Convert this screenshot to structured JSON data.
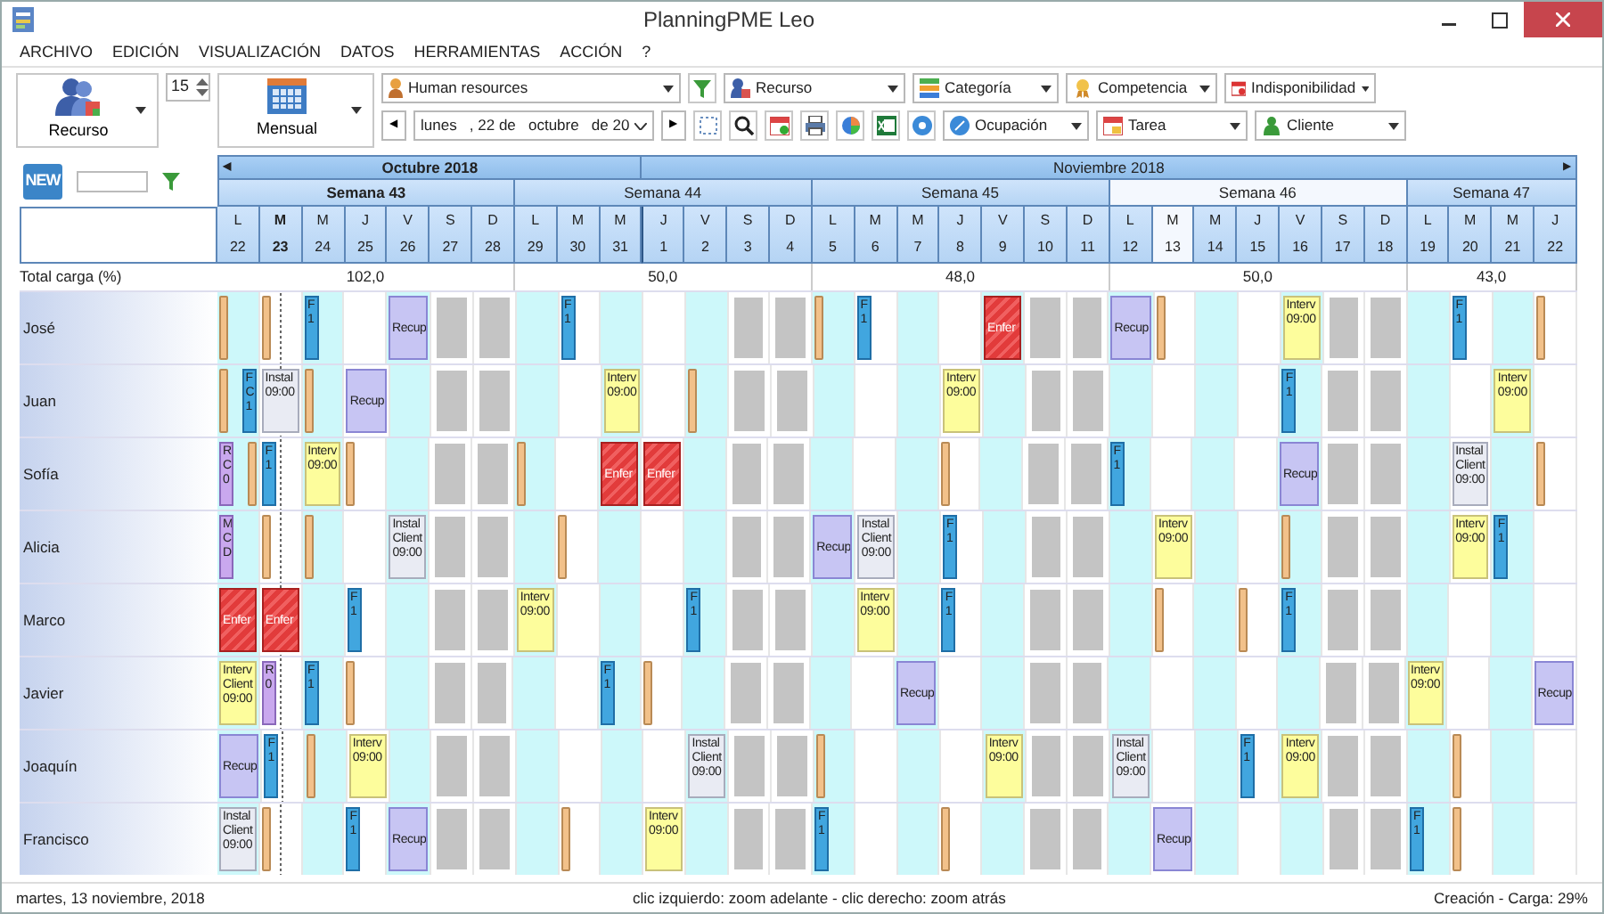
{
  "window": {
    "title": "PlanningPME Leo"
  },
  "menu": [
    {
      "label": "ARCHIVO"
    },
    {
      "label": "EDICIÓN"
    },
    {
      "label": "VISUALIZACIÓN"
    },
    {
      "label": "DATOS"
    },
    {
      "label": "HERRAMIENTAS"
    },
    {
      "label": "ACCIÓN"
    },
    {
      "label": "?"
    }
  ],
  "toolbar": {
    "view_button": {
      "label": "Recurso"
    },
    "count": "15",
    "period_button": {
      "label": "Mensual"
    },
    "resource_group": "Human resources",
    "prev": "◀",
    "date_field": "lunes   , 22 de   octubre   de 20",
    "next": "▶",
    "filters_top": [
      {
        "label": "Recurso"
      },
      {
        "label": "Categoría"
      },
      {
        "label": "Competencia"
      },
      {
        "label": "Indisponibilidad"
      }
    ],
    "filters_bottom": [
      {
        "label": "Ocupación"
      },
      {
        "label": "Tarea"
      },
      {
        "label": "Cliente"
      }
    ]
  },
  "planner": {
    "new_button": "NEW",
    "total_label": "Total carga (%)",
    "prev": "◀",
    "next": "▶",
    "months": [
      {
        "label": "Octubre 2018",
        "current": true
      },
      {
        "label": "Noviembre 2018",
        "current": false
      }
    ],
    "weeks": [
      {
        "label": "Semana 43",
        "total": "102,0",
        "current": true,
        "selected": false,
        "days": [
          {
            "weekday": "L",
            "date": "22",
            "current": false,
            "selected": false,
            "month_start": false
          },
          {
            "weekday": "M",
            "date": "23",
            "current": true,
            "selected": false,
            "month_start": false
          },
          {
            "weekday": "M",
            "date": "24",
            "current": false,
            "selected": false,
            "month_start": false
          },
          {
            "weekday": "J",
            "date": "25",
            "current": false,
            "selected": false,
            "month_start": false
          },
          {
            "weekday": "V",
            "date": "26",
            "current": false,
            "selected": false,
            "month_start": false
          },
          {
            "weekday": "S",
            "date": "27",
            "current": false,
            "selected": false,
            "month_start": false
          },
          {
            "weekday": "D",
            "date": "28",
            "current": false,
            "selected": false,
            "month_start": false
          }
        ]
      },
      {
        "label": "Semana 44",
        "total": "50,0",
        "current": false,
        "selected": false,
        "days": [
          {
            "weekday": "L",
            "date": "29",
            "current": false,
            "selected": false,
            "month_start": false
          },
          {
            "weekday": "M",
            "date": "30",
            "current": false,
            "selected": false,
            "month_start": false
          },
          {
            "weekday": "M",
            "date": "31",
            "current": false,
            "selected": false,
            "month_start": false
          },
          {
            "weekday": "J",
            "date": "1",
            "current": false,
            "selected": false,
            "month_start": true
          },
          {
            "weekday": "V",
            "date": "2",
            "current": false,
            "selected": false,
            "month_start": false
          },
          {
            "weekday": "S",
            "date": "3",
            "current": false,
            "selected": false,
            "month_start": false
          },
          {
            "weekday": "D",
            "date": "4",
            "current": false,
            "selected": false,
            "month_start": false
          }
        ]
      },
      {
        "label": "Semana 45",
        "total": "48,0",
        "current": false,
        "selected": false,
        "days": [
          {
            "weekday": "L",
            "date": "5",
            "current": false,
            "selected": false,
            "month_start": false
          },
          {
            "weekday": "M",
            "date": "6",
            "current": false,
            "selected": false,
            "month_start": false
          },
          {
            "weekday": "M",
            "date": "7",
            "current": false,
            "selected": false,
            "month_start": false
          },
          {
            "weekday": "J",
            "date": "8",
            "current": false,
            "selected": false,
            "month_start": false
          },
          {
            "weekday": "V",
            "date": "9",
            "current": false,
            "selected": false,
            "month_start": false
          },
          {
            "weekday": "S",
            "date": "10",
            "current": false,
            "selected": false,
            "month_start": false
          },
          {
            "weekday": "D",
            "date": "11",
            "current": false,
            "selected": false,
            "month_start": false
          }
        ]
      },
      {
        "label": "Semana 46",
        "total": "50,0",
        "current": false,
        "selected": true,
        "days": [
          {
            "weekday": "L",
            "date": "12",
            "current": false,
            "selected": false,
            "month_start": false
          },
          {
            "weekday": "M",
            "date": "13",
            "current": false,
            "selected": true,
            "month_start": false
          },
          {
            "weekday": "M",
            "date": "14",
            "current": false,
            "selected": false,
            "month_start": false
          },
          {
            "weekday": "J",
            "date": "15",
            "current": false,
            "selected": false,
            "month_start": false
          },
          {
            "weekday": "V",
            "date": "16",
            "current": false,
            "selected": false,
            "month_start": false
          },
          {
            "weekday": "S",
            "date": "17",
            "current": false,
            "selected": false,
            "month_start": false
          },
          {
            "weekday": "D",
            "date": "18",
            "current": false,
            "selected": false,
            "month_start": false
          }
        ]
      },
      {
        "label": "Semana 47",
        "total": "43,0",
        "current": false,
        "selected": false,
        "days": [
          {
            "weekday": "L",
            "date": "19",
            "current": false,
            "selected": false,
            "month_start": false
          },
          {
            "weekday": "M",
            "date": "20",
            "current": false,
            "selected": false,
            "month_start": false
          },
          {
            "weekday": "M",
            "date": "21",
            "current": false,
            "selected": false,
            "month_start": false
          },
          {
            "weekday": "J",
            "date": "22",
            "current": false,
            "selected": false,
            "month_start": false
          }
        ]
      }
    ],
    "resources": [
      {
        "name": "José",
        "cells": [
          {
            "kind": "shaded",
            "events": [
              {
                "kind": "marker"
              }
            ]
          },
          {
            "kind": "plain",
            "events": [
              {
                "kind": "marker"
              }
            ]
          },
          {
            "kind": "shaded",
            "events": [
              {
                "kind": "task",
                "lines": [
                  "F",
                  "1"
                ]
              }
            ]
          },
          {
            "kind": "plain"
          },
          {
            "kind": "shaded",
            "events": [
              {
                "kind": "recup",
                "lines": [
                  "Recup"
                ]
              }
            ]
          },
          {
            "kind": "weekend"
          },
          {
            "kind": "weekend"
          },
          {
            "kind": "shaded"
          },
          {
            "kind": "plain",
            "events": [
              {
                "kind": "task",
                "lines": [
                  "F",
                  "1"
                ]
              }
            ]
          },
          {
            "kind": "shaded"
          },
          {
            "kind": "plain"
          },
          {
            "kind": "shaded"
          },
          {
            "kind": "weekend"
          },
          {
            "kind": "weekend"
          },
          {
            "kind": "shaded",
            "events": [
              {
                "kind": "marker"
              }
            ]
          },
          {
            "kind": "plain",
            "events": [
              {
                "kind": "task",
                "lines": [
                  "F",
                  "1"
                ]
              }
            ]
          },
          {
            "kind": "shaded"
          },
          {
            "kind": "plain"
          },
          {
            "kind": "shaded",
            "events": [
              {
                "kind": "enfer",
                "lines": [
                  "Enfer"
                ]
              }
            ]
          },
          {
            "kind": "weekend"
          },
          {
            "kind": "weekend"
          },
          {
            "kind": "shaded",
            "events": [
              {
                "kind": "recup",
                "lines": [
                  "Recup"
                ]
              }
            ]
          },
          {
            "kind": "plain",
            "events": [
              {
                "kind": "marker"
              }
            ]
          },
          {
            "kind": "shaded"
          },
          {
            "kind": "plain"
          },
          {
            "kind": "shaded",
            "events": [
              {
                "kind": "interv",
                "lines": [
                  "Interv",
                  "09:00"
                ]
              }
            ]
          },
          {
            "kind": "weekend"
          },
          {
            "kind": "weekend"
          },
          {
            "kind": "shaded"
          },
          {
            "kind": "plain",
            "events": [
              {
                "kind": "task",
                "lines": [
                  "F",
                  "1"
                ]
              }
            ]
          },
          {
            "kind": "shaded"
          },
          {
            "kind": "plain",
            "events": [
              {
                "kind": "marker"
              }
            ]
          }
        ]
      },
      {
        "name": "Juan",
        "cells": [
          {
            "kind": "shaded",
            "events": [
              {
                "kind": "marker"
              },
              {
                "kind": "task",
                "lines": [
                  "F",
                  "C",
                  "1"
                ]
              }
            ]
          },
          {
            "kind": "plain",
            "events": [
              {
                "kind": "instal",
                "lines": [
                  "Instal",
                  "09:00"
                ]
              }
            ]
          },
          {
            "kind": "shaded",
            "events": [
              {
                "kind": "marker"
              }
            ]
          },
          {
            "kind": "plain",
            "events": [
              {
                "kind": "recup",
                "lines": [
                  "Recup"
                ]
              }
            ]
          },
          {
            "kind": "shaded"
          },
          {
            "kind": "weekend"
          },
          {
            "kind": "weekend"
          },
          {
            "kind": "shaded"
          },
          {
            "kind": "plain"
          },
          {
            "kind": "shaded",
            "events": [
              {
                "kind": "interv",
                "lines": [
                  "Interv",
                  "09:00"
                ]
              }
            ]
          },
          {
            "kind": "plain"
          },
          {
            "kind": "shaded",
            "events": [
              {
                "kind": "marker"
              }
            ]
          },
          {
            "kind": "weekend"
          },
          {
            "kind": "weekend"
          },
          {
            "kind": "shaded"
          },
          {
            "kind": "plain"
          },
          {
            "kind": "shaded"
          },
          {
            "kind": "plain",
            "events": [
              {
                "kind": "interv",
                "lines": [
                  "Interv",
                  "09:00"
                ]
              }
            ]
          },
          {
            "kind": "shaded"
          },
          {
            "kind": "weekend"
          },
          {
            "kind": "weekend"
          },
          {
            "kind": "shaded"
          },
          {
            "kind": "plain"
          },
          {
            "kind": "shaded"
          },
          {
            "kind": "plain"
          },
          {
            "kind": "shaded",
            "events": [
              {
                "kind": "task",
                "lines": [
                  "F",
                  "1"
                ]
              }
            ]
          },
          {
            "kind": "weekend"
          },
          {
            "kind": "weekend"
          },
          {
            "kind": "shaded"
          },
          {
            "kind": "plain"
          },
          {
            "kind": "shaded",
            "events": [
              {
                "kind": "interv",
                "lines": [
                  "Interv",
                  "09:00"
                ]
              }
            ]
          },
          {
            "kind": "plain"
          }
        ]
      },
      {
        "name": "Sofía",
        "cells": [
          {
            "kind": "shaded",
            "events": [
              {
                "kind": "note",
                "lines": [
                  "R",
                  "C",
                  "0"
                ]
              },
              {
                "kind": "marker"
              }
            ]
          },
          {
            "kind": "plain",
            "events": [
              {
                "kind": "task",
                "lines": [
                  "F",
                  "1"
                ]
              }
            ]
          },
          {
            "kind": "shaded",
            "events": [
              {
                "kind": "interv",
                "lines": [
                  "Interv",
                  "09:00"
                ]
              }
            ]
          },
          {
            "kind": "plain",
            "events": [
              {
                "kind": "marker"
              }
            ]
          },
          {
            "kind": "shaded"
          },
          {
            "kind": "weekend"
          },
          {
            "kind": "weekend"
          },
          {
            "kind": "shaded",
            "events": [
              {
                "kind": "marker"
              }
            ]
          },
          {
            "kind": "plain"
          },
          {
            "kind": "shaded",
            "events": [
              {
                "kind": "enfer",
                "lines": [
                  "Enfer"
                ]
              }
            ]
          },
          {
            "kind": "plain",
            "events": [
              {
                "kind": "enfer",
                "lines": [
                  "Enfer"
                ]
              }
            ]
          },
          {
            "kind": "shaded"
          },
          {
            "kind": "weekend"
          },
          {
            "kind": "weekend"
          },
          {
            "kind": "shaded"
          },
          {
            "kind": "plain"
          },
          {
            "kind": "shaded"
          },
          {
            "kind": "plain",
            "events": [
              {
                "kind": "marker"
              }
            ]
          },
          {
            "kind": "shaded"
          },
          {
            "kind": "weekend"
          },
          {
            "kind": "weekend"
          },
          {
            "kind": "shaded",
            "events": [
              {
                "kind": "task",
                "lines": [
                  "F",
                  "1"
                ]
              }
            ]
          },
          {
            "kind": "plain"
          },
          {
            "kind": "shaded"
          },
          {
            "kind": "plain"
          },
          {
            "kind": "shaded",
            "events": [
              {
                "kind": "recup",
                "lines": [
                  "Recup"
                ]
              }
            ]
          },
          {
            "kind": "weekend"
          },
          {
            "kind": "weekend"
          },
          {
            "kind": "shaded"
          },
          {
            "kind": "plain",
            "events": [
              {
                "kind": "instal",
                "lines": [
                  "Instal",
                  "Client",
                  "09:00"
                ]
              }
            ]
          },
          {
            "kind": "shaded"
          },
          {
            "kind": "plain",
            "events": [
              {
                "kind": "marker"
              }
            ]
          }
        ]
      },
      {
        "name": "Alicia",
        "cells": [
          {
            "kind": "shaded",
            "events": [
              {
                "kind": "note",
                "lines": [
                  "M",
                  "C",
                  "D"
                ]
              }
            ]
          },
          {
            "kind": "plain",
            "events": [
              {
                "kind": "marker"
              }
            ]
          },
          {
            "kind": "shaded",
            "events": [
              {
                "kind": "marker"
              }
            ]
          },
          {
            "kind": "plain"
          },
          {
            "kind": "shaded",
            "events": [
              {
                "kind": "instal",
                "lines": [
                  "Instal",
                  "Client",
                  "09:00"
                ]
              }
            ]
          },
          {
            "kind": "weekend"
          },
          {
            "kind": "weekend"
          },
          {
            "kind": "shaded"
          },
          {
            "kind": "plain",
            "events": [
              {
                "kind": "marker"
              }
            ]
          },
          {
            "kind": "shaded"
          },
          {
            "kind": "plain"
          },
          {
            "kind": "shaded"
          },
          {
            "kind": "weekend"
          },
          {
            "kind": "weekend"
          },
          {
            "kind": "shaded",
            "events": [
              {
                "kind": "recup",
                "lines": [
                  "Recup"
                ]
              }
            ]
          },
          {
            "kind": "plain",
            "events": [
              {
                "kind": "instal",
                "lines": [
                  "Instal",
                  "Client",
                  "09:00"
                ]
              }
            ]
          },
          {
            "kind": "shaded"
          },
          {
            "kind": "plain",
            "events": [
              {
                "kind": "task",
                "lines": [
                  "F",
                  "1"
                ]
              }
            ]
          },
          {
            "kind": "shaded"
          },
          {
            "kind": "weekend"
          },
          {
            "kind": "weekend"
          },
          {
            "kind": "shaded"
          },
          {
            "kind": "plain",
            "events": [
              {
                "kind": "interv",
                "lines": [
                  "Interv",
                  "09:00"
                ]
              }
            ]
          },
          {
            "kind": "shaded"
          },
          {
            "kind": "plain"
          },
          {
            "kind": "shaded",
            "events": [
              {
                "kind": "marker"
              }
            ]
          },
          {
            "kind": "weekend"
          },
          {
            "kind": "weekend"
          },
          {
            "kind": "shaded"
          },
          {
            "kind": "plain",
            "events": [
              {
                "kind": "interv",
                "lines": [
                  "Interv",
                  "09:00"
                ]
              }
            ]
          },
          {
            "kind": "shaded",
            "events": [
              {
                "kind": "task",
                "lines": [
                  "F",
                  "1"
                ]
              }
            ]
          },
          {
            "kind": "plain"
          }
        ]
      },
      {
        "name": "Marco",
        "cells": [
          {
            "kind": "shaded",
            "events": [
              {
                "kind": "enfer",
                "lines": [
                  "Enfer"
                ]
              }
            ]
          },
          {
            "kind": "plain",
            "events": [
              {
                "kind": "enfer",
                "lines": [
                  "Enfer"
                ]
              }
            ]
          },
          {
            "kind": "shaded"
          },
          {
            "kind": "plain",
            "events": [
              {
                "kind": "task",
                "lines": [
                  "F",
                  "1"
                ]
              }
            ]
          },
          {
            "kind": "shaded"
          },
          {
            "kind": "weekend"
          },
          {
            "kind": "weekend"
          },
          {
            "kind": "shaded",
            "events": [
              {
                "kind": "interv",
                "lines": [
                  "Interv",
                  "09:00"
                ]
              }
            ]
          },
          {
            "kind": "plain"
          },
          {
            "kind": "shaded"
          },
          {
            "kind": "plain"
          },
          {
            "kind": "shaded",
            "events": [
              {
                "kind": "task",
                "lines": [
                  "F",
                  "1"
                ]
              }
            ]
          },
          {
            "kind": "weekend"
          },
          {
            "kind": "weekend"
          },
          {
            "kind": "shaded"
          },
          {
            "kind": "plain",
            "events": [
              {
                "kind": "interv",
                "lines": [
                  "Interv",
                  "09:00"
                ]
              }
            ]
          },
          {
            "kind": "shaded"
          },
          {
            "kind": "plain",
            "events": [
              {
                "kind": "task",
                "lines": [
                  "F",
                  "1"
                ]
              }
            ]
          },
          {
            "kind": "shaded"
          },
          {
            "kind": "weekend"
          },
          {
            "kind": "weekend"
          },
          {
            "kind": "shaded"
          },
          {
            "kind": "plain",
            "events": [
              {
                "kind": "marker"
              }
            ]
          },
          {
            "kind": "shaded"
          },
          {
            "kind": "plain",
            "events": [
              {
                "kind": "marker"
              }
            ]
          },
          {
            "kind": "shaded",
            "events": [
              {
                "kind": "task",
                "lines": [
                  "F",
                  "1"
                ]
              }
            ]
          },
          {
            "kind": "weekend"
          },
          {
            "kind": "weekend"
          },
          {
            "kind": "shaded"
          },
          {
            "kind": "plain"
          },
          {
            "kind": "shaded"
          },
          {
            "kind": "plain"
          }
        ]
      },
      {
        "name": "Javier",
        "cells": [
          {
            "kind": "shaded",
            "events": [
              {
                "kind": "interv",
                "lines": [
                  "Interv",
                  "Client",
                  "09:00"
                ]
              }
            ]
          },
          {
            "kind": "plain",
            "events": [
              {
                "kind": "note",
                "lines": [
                  "R",
                  "0"
                ]
              }
            ]
          },
          {
            "kind": "shaded",
            "events": [
              {
                "kind": "task",
                "lines": [
                  "F",
                  "1"
                ]
              }
            ]
          },
          {
            "kind": "plain",
            "events": [
              {
                "kind": "marker"
              }
            ]
          },
          {
            "kind": "shaded"
          },
          {
            "kind": "weekend"
          },
          {
            "kind": "weekend"
          },
          {
            "kind": "shaded"
          },
          {
            "kind": "plain"
          },
          {
            "kind": "shaded",
            "events": [
              {
                "kind": "task",
                "lines": [
                  "F",
                  "1"
                ]
              }
            ]
          },
          {
            "kind": "plain",
            "events": [
              {
                "kind": "marker"
              }
            ]
          },
          {
            "kind": "shaded"
          },
          {
            "kind": "weekend"
          },
          {
            "kind": "weekend"
          },
          {
            "kind": "shaded"
          },
          {
            "kind": "plain"
          },
          {
            "kind": "shaded",
            "events": [
              {
                "kind": "recup",
                "lines": [
                  "Recup"
                ]
              }
            ]
          },
          {
            "kind": "plain"
          },
          {
            "kind": "shaded"
          },
          {
            "kind": "weekend"
          },
          {
            "kind": "weekend"
          },
          {
            "kind": "shaded"
          },
          {
            "kind": "plain"
          },
          {
            "kind": "shaded"
          },
          {
            "kind": "plain"
          },
          {
            "kind": "shaded"
          },
          {
            "kind": "weekend"
          },
          {
            "kind": "weekend"
          },
          {
            "kind": "shaded",
            "events": [
              {
                "kind": "interv",
                "lines": [
                  "Interv",
                  "09:00"
                ]
              }
            ]
          },
          {
            "kind": "plain"
          },
          {
            "kind": "shaded"
          },
          {
            "kind": "plain",
            "events": [
              {
                "kind": "recup",
                "lines": [
                  "Recup"
                ]
              }
            ]
          }
        ]
      },
      {
        "name": "Joaquín",
        "cells": [
          {
            "kind": "shaded",
            "events": [
              {
                "kind": "recup",
                "lines": [
                  "Recup"
                ]
              }
            ]
          },
          {
            "kind": "plain",
            "events": [
              {
                "kind": "task",
                "lines": [
                  "F",
                  "1"
                ]
              }
            ]
          },
          {
            "kind": "shaded",
            "events": [
              {
                "kind": "marker"
              }
            ]
          },
          {
            "kind": "plain",
            "events": [
              {
                "kind": "interv",
                "lines": [
                  "Interv",
                  "09:00"
                ]
              }
            ]
          },
          {
            "kind": "shaded"
          },
          {
            "kind": "weekend"
          },
          {
            "kind": "weekend"
          },
          {
            "kind": "shaded"
          },
          {
            "kind": "plain"
          },
          {
            "kind": "shaded"
          },
          {
            "kind": "plain"
          },
          {
            "kind": "shaded",
            "events": [
              {
                "kind": "instal",
                "lines": [
                  "Instal",
                  "Client",
                  "09:00"
                ]
              }
            ]
          },
          {
            "kind": "weekend"
          },
          {
            "kind": "weekend"
          },
          {
            "kind": "shaded",
            "events": [
              {
                "kind": "marker"
              }
            ]
          },
          {
            "kind": "plain"
          },
          {
            "kind": "shaded"
          },
          {
            "kind": "plain"
          },
          {
            "kind": "shaded",
            "events": [
              {
                "kind": "interv",
                "lines": [
                  "Interv",
                  "09:00"
                ]
              }
            ]
          },
          {
            "kind": "weekend"
          },
          {
            "kind": "weekend"
          },
          {
            "kind": "shaded",
            "events": [
              {
                "kind": "instal",
                "lines": [
                  "Instal",
                  "Client",
                  "09:00"
                ]
              }
            ]
          },
          {
            "kind": "plain"
          },
          {
            "kind": "shaded"
          },
          {
            "kind": "plain",
            "events": [
              {
                "kind": "task",
                "lines": [
                  "F",
                  "1"
                ]
              }
            ]
          },
          {
            "kind": "shaded",
            "events": [
              {
                "kind": "interv",
                "lines": [
                  "Interv",
                  "09:00"
                ]
              }
            ]
          },
          {
            "kind": "weekend"
          },
          {
            "kind": "weekend"
          },
          {
            "kind": "shaded"
          },
          {
            "kind": "plain",
            "events": [
              {
                "kind": "marker"
              }
            ]
          },
          {
            "kind": "shaded"
          },
          {
            "kind": "plain"
          }
        ]
      },
      {
        "name": "Francisco",
        "cells": [
          {
            "kind": "shaded",
            "events": [
              {
                "kind": "instal",
                "lines": [
                  "Instal",
                  "Client",
                  "09:00"
                ]
              }
            ]
          },
          {
            "kind": "plain",
            "events": [
              {
                "kind": "marker"
              }
            ]
          },
          {
            "kind": "shaded"
          },
          {
            "kind": "plain",
            "events": [
              {
                "kind": "task",
                "lines": [
                  "F",
                  "1"
                ]
              }
            ]
          },
          {
            "kind": "shaded",
            "events": [
              {
                "kind": "recup",
                "lines": [
                  "Recup"
                ]
              }
            ]
          },
          {
            "kind": "weekend"
          },
          {
            "kind": "weekend"
          },
          {
            "kind": "shaded"
          },
          {
            "kind": "plain",
            "events": [
              {
                "kind": "marker"
              }
            ]
          },
          {
            "kind": "shaded"
          },
          {
            "kind": "plain",
            "events": [
              {
                "kind": "interv",
                "lines": [
                  "Interv",
                  "09:00"
                ]
              }
            ]
          },
          {
            "kind": "shaded"
          },
          {
            "kind": "weekend"
          },
          {
            "kind": "weekend"
          },
          {
            "kind": "shaded",
            "events": [
              {
                "kind": "task",
                "lines": [
                  "F",
                  "1"
                ]
              }
            ]
          },
          {
            "kind": "plain"
          },
          {
            "kind": "shaded"
          },
          {
            "kind": "plain",
            "events": [
              {
                "kind": "marker"
              }
            ]
          },
          {
            "kind": "shaded"
          },
          {
            "kind": "weekend"
          },
          {
            "kind": "weekend"
          },
          {
            "kind": "shaded"
          },
          {
            "kind": "plain",
            "events": [
              {
                "kind": "recup",
                "lines": [
                  "Recup"
                ]
              }
            ]
          },
          {
            "kind": "shaded"
          },
          {
            "kind": "plain"
          },
          {
            "kind": "shaded"
          },
          {
            "kind": "weekend"
          },
          {
            "kind": "weekend"
          },
          {
            "kind": "shaded",
            "events": [
              {
                "kind": "task",
                "lines": [
                  "F",
                  "1"
                ]
              }
            ]
          },
          {
            "kind": "plain",
            "events": [
              {
                "kind": "marker"
              }
            ]
          },
          {
            "kind": "shaded"
          },
          {
            "kind": "plain"
          }
        ]
      }
    ]
  },
  "status_bar": {
    "date": "martes, 13 noviembre, 2018",
    "hint": "clic izquierdo: zoom adelante - clic derecho: zoom atrás",
    "load": "Creación - Carga: 29%"
  }
}
